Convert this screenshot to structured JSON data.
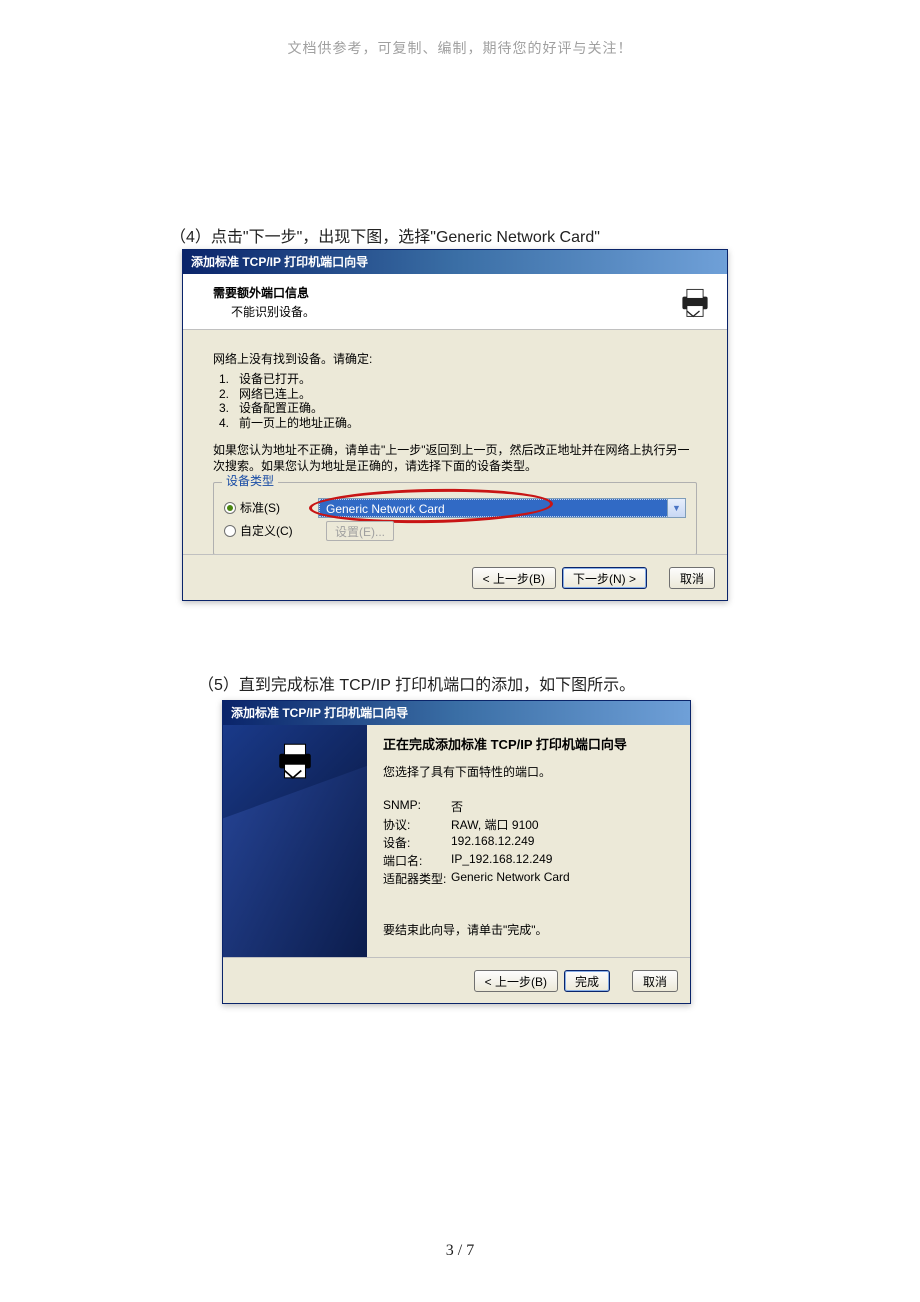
{
  "header_note": "文档供参考，可复制、编制，期待您的好评与关注！",
  "step4_text": "（4）点击\"下一步\"，出现下图，选择\"Generic Network Card\"",
  "dlg1": {
    "title": "添加标准 TCP/IP 打印机端口向导",
    "header_title": "需要额外端口信息",
    "header_sub": "不能识别设备。",
    "notfound": "网络上没有找到设备。请确定:",
    "items": [
      "设备已打开。",
      "网络已连上。",
      "设备配置正确。",
      "前一页上的地址正确。"
    ],
    "advice": "如果您认为地址不正确，请单击\"上一步\"返回到上一页，然后改正地址并在网络上执行另一次搜索。如果您认为地址是正确的，请选择下面的设备类型。",
    "group_label": "设备类型",
    "radio_standard": "标准(S)",
    "combo_value": "Generic Network Card",
    "radio_custom": "自定义(C)",
    "settings_btn": "设置(E)...",
    "back": "< 上一步(B)",
    "next": "下一步(N) >",
    "cancel": "取消"
  },
  "step5_text": "（5）直到完成标准 TCP/IP 打印机端口的添加，如下图所示。",
  "dlg2": {
    "title": "添加标准 TCP/IP 打印机端口向导",
    "heading": "正在完成添加标准 TCP/IP 打印机端口向导",
    "sub": "您选择了具有下面特性的端口。",
    "kv": [
      [
        "SNMP:",
        "否"
      ],
      [
        "协议:",
        "RAW, 端口 9100"
      ],
      [
        "设备:",
        "192.168.12.249"
      ],
      [
        "端口名:",
        "IP_192.168.12.249"
      ],
      [
        "适配器类型:",
        "Generic Network Card"
      ]
    ],
    "finish_hint": "要结束此向导，请单击\"完成\"。",
    "back": "< 上一步(B)",
    "finish": "完成",
    "cancel": "取消"
  },
  "footer": "3 / 7"
}
